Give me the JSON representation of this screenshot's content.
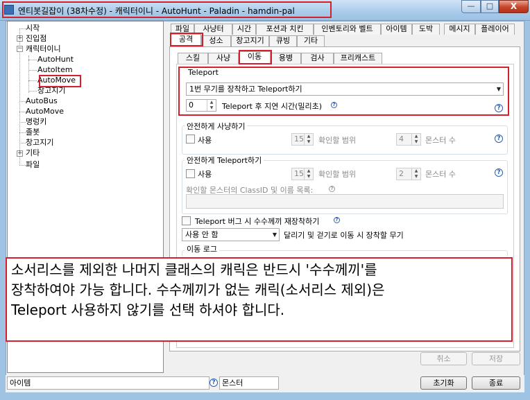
{
  "window": {
    "title": "엔티봇길잡이 (38차수정) - 캐릭터이니 - AutoHunt - Paladin - hamdin-pal",
    "close_glyph": "X",
    "min_glyph": "—",
    "max_glyph": "□"
  },
  "tree": {
    "items": {
      "start": "시작",
      "enter": "진입점",
      "char": "캐릭터이니",
      "autohunt": "AutoHunt",
      "autoitem": "AutoItem",
      "automove": "AutoMove",
      "warehouse_sub": "창고지기",
      "autobus": "AutoBus",
      "automove2": "AutoMove",
      "nameplate": "명렁키",
      "jolbot": "졸봇",
      "warehouse": "창고지기",
      "etc": "기타",
      "file": "파일"
    },
    "plus": "+",
    "minus": "−"
  },
  "tabs_row1": [
    "파일",
    "사냥터",
    "시간",
    "포션과 치킨",
    "인벤토리와 벨트",
    "아이템",
    "도박",
    "메시지",
    "플레이어"
  ],
  "tabs_row2": [
    "공격",
    "성소",
    "창고지기",
    "큐빙",
    "기타"
  ],
  "tabs_row3": [
    "스킬",
    "사냥",
    "이동",
    "용병",
    "검사",
    "프리캐스트"
  ],
  "teleport": {
    "group_title": "Teleport",
    "mode_select": "1번 무기를 장착하고 Teleport하기",
    "delay_value": "0",
    "delay_label": "Teleport 후 지연 시간(밀리초)"
  },
  "safe_hunt": {
    "group_title": "안전하게 사냥하기",
    "use_label": "사용",
    "range_value": "15",
    "range_label": "확인할 범위",
    "count_value": "4",
    "count_label": "몬스터 수"
  },
  "safe_teleport": {
    "group_title": "안전하게 Teleport하기",
    "use_label": "사용",
    "range_value": "15",
    "range_label": "확인할 범위",
    "count_value": "2",
    "count_label": "몬스터 수",
    "list_label": "확인할 몬스터의 ClassID 및 이름 목록:"
  },
  "bug_reequip_label": "Teleport 버그 시 수수께끼 재장착하기",
  "weapon_select": "사용 안 함",
  "weapon_label": "달리기 및 걷기로 이동 시 장착할 무기",
  "move_log_title": "이동 로그",
  "help_glyph": "?",
  "notice": {
    "lines": [
      "소서리스를 제외한 나머지 클래스의 캐릭은 반드시 '수수께끼'를",
      "장착하여야 가능 합니다. 수수께끼가 없는 캐릭(소서리스 제외)은",
      "Teleport 사용하지 않기를 선택 하셔야 합니다."
    ]
  },
  "buttons": {
    "cancel": "취소",
    "save": "저장",
    "reset": "초기화",
    "exit": "종료"
  },
  "status": {
    "item_field": "아이템",
    "monster_field": "몬스터"
  }
}
